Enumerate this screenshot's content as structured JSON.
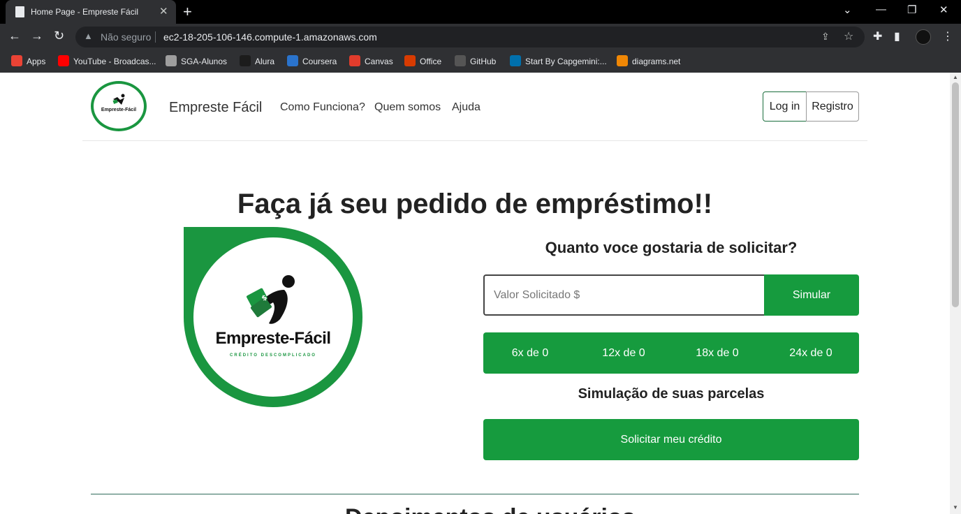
{
  "browser": {
    "tab_title": "Home Page - Empreste Fácil",
    "new_tab": "+",
    "security_label": "Não seguro",
    "url": "ec2-18-205-106-146.compute-1.amazonaws.com",
    "bookmarks": [
      {
        "label": "Apps",
        "color": "#ea4335"
      },
      {
        "label": "YouTube - Broadcas...",
        "color": "#ff0000"
      },
      {
        "label": "SGA-Alunos",
        "color": "#9e9e9e"
      },
      {
        "label": "Alura",
        "color": "#1c1c1c"
      },
      {
        "label": "Coursera",
        "color": "#2a73cc"
      },
      {
        "label": "Canvas",
        "color": "#e13c2c"
      },
      {
        "label": "Office",
        "color": "#d83b01"
      },
      {
        "label": "GitHub",
        "color": "#555555"
      },
      {
        "label": "Start By Capgemini:...",
        "color": "#0070ad"
      },
      {
        "label": "diagrams.net",
        "color": "#f08705"
      }
    ]
  },
  "header": {
    "logo_text": "Empreste-Fácil",
    "brand": "Empreste Fácil",
    "nav": [
      "Como Funciona?",
      "Quem somos",
      "Ajuda"
    ],
    "login": "Log in",
    "register": "Registro"
  },
  "hero": {
    "title": "Faça já seu pedido de empréstimo!!",
    "logo_word": "Empreste-Fácil",
    "logo_tagline": "CRÉDITO DESCOMPLICADO"
  },
  "form": {
    "question": "Quanto voce gostaria de solicitar?",
    "input_placeholder": "Valor Solicitado $",
    "simulate": "Simular",
    "installments": [
      "6x de 0",
      "12x de 0",
      "18x de 0",
      "24x de 0"
    ],
    "simulation_title": "Simulação de suas parcelas",
    "request_button": "Solicitar meu crédito"
  },
  "next_section": {
    "title_partial": "Depoimentos de usuários"
  },
  "colors": {
    "accent_green": "#169b3e",
    "outline_green": "#1a6e3c"
  }
}
